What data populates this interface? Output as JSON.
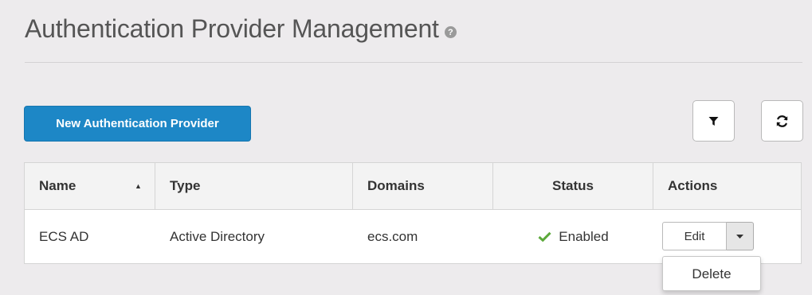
{
  "page": {
    "title": "Authentication Provider Management",
    "help_icon": "question-circle",
    "help_glyph": "?"
  },
  "toolbar": {
    "new_button_label": "New Authentication Provider",
    "filter_icon": "filter",
    "refresh_icon": "refresh"
  },
  "table": {
    "columns": [
      "Name",
      "Type",
      "Domains",
      "Status",
      "Actions"
    ],
    "sort_column": "Name",
    "sort_direction": "ascending",
    "sort_glyph": "▲",
    "rows": [
      {
        "name": "ECS AD",
        "type": "Active Directory",
        "domains": "ecs.com",
        "status": "Enabled",
        "status_icon": "checkmark"
      }
    ]
  },
  "actions": {
    "edit_label": "Edit",
    "caret_icon": "caret-down",
    "menu_items": [
      "Delete"
    ]
  },
  "colors": {
    "background": "#edebed",
    "primary": "#1d87c6",
    "success": "#5ca93b",
    "text": "#333333",
    "title": "#555555"
  }
}
